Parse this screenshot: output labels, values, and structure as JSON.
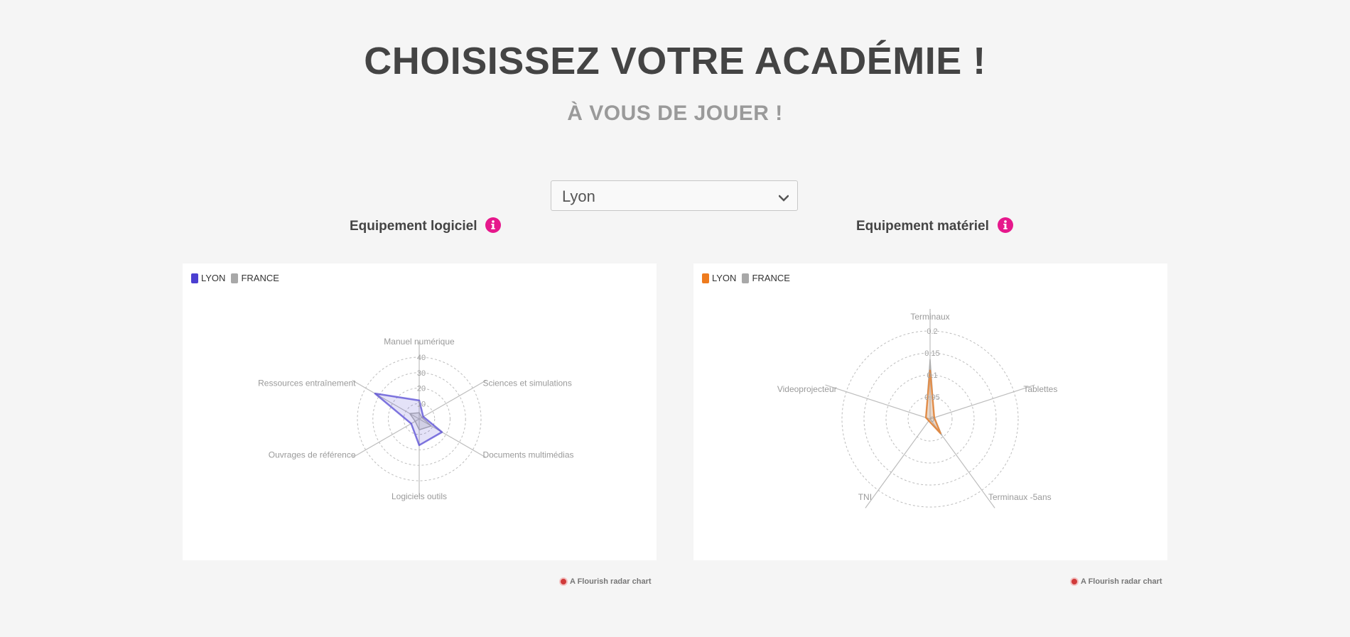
{
  "header": {
    "title": "CHOISISSEZ VOTRE ACADÉMIE !",
    "subtitle": "À VOUS DE JOUER !"
  },
  "selector": {
    "value": "Lyon"
  },
  "colors": {
    "logiciel_lyon": "#4b3fd1",
    "materiel_lyon": "#ee7b1e",
    "france": "#a8a8a8",
    "info": "#e6188c"
  },
  "credit_text": "A Flourish radar chart",
  "chart_data": [
    {
      "type": "radar",
      "title": "Equipement logiciel",
      "axes": [
        "Manuel numérique",
        "Sciences et simulations",
        "Documents multimédias",
        "Logiciels outils",
        "Ouvrages de référence",
        "Ressources entraînement"
      ],
      "ticks": [
        "10",
        "20",
        "30",
        "40"
      ],
      "rmax": 40,
      "legend": [
        "LYON",
        "FRANCE"
      ],
      "legend_position": "top-left",
      "series": [
        {
          "name": "LYON",
          "values": [
            12,
            3,
            17,
            17,
            6,
            33
          ]
        },
        {
          "name": "FRANCE",
          "values": [
            4,
            2,
            9,
            7,
            3,
            7
          ]
        }
      ]
    },
    {
      "type": "radar",
      "title": "Equipement matériel",
      "axes": [
        "Terminaux",
        "Tablettes",
        "Terminaux -5ans",
        "TNI",
        "Videoprojecteur"
      ],
      "ticks": [
        "0",
        "0.05",
        "0.1",
        "0.15",
        "0.2"
      ],
      "rmax": 0.2,
      "legend": [
        "LYON",
        "FRANCE"
      ],
      "legend_position": "top-left",
      "series": [
        {
          "name": "LYON",
          "values": [
            0.11,
            0.01,
            0.04,
            0.005,
            0.01
          ]
        },
        {
          "name": "FRANCE",
          "values": [
            0.135,
            0.01,
            0.045,
            0.005,
            0.01
          ]
        }
      ]
    }
  ]
}
